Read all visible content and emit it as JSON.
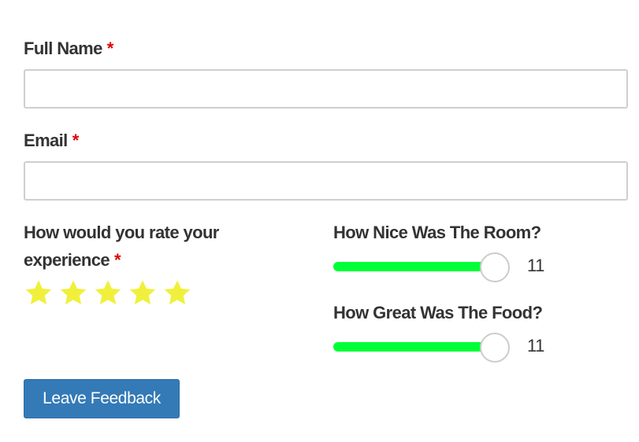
{
  "form": {
    "full_name": {
      "label": "Full Name",
      "required_mark": "*",
      "value": "",
      "placeholder": ""
    },
    "email": {
      "label": "Email",
      "required_mark": "*",
      "value": "",
      "placeholder": ""
    },
    "rating": {
      "label_line1": "How would you rate your",
      "label_line2": "experience",
      "required_mark": "*",
      "value": 5,
      "max": 5,
      "star_color": "#f0f03c"
    },
    "room_slider": {
      "label": "How Nice Was The Room?",
      "value": "11",
      "fraction": 1.0
    },
    "food_slider": {
      "label": "How Great Was The Food?",
      "value": "11",
      "fraction": 1.0
    },
    "submit_label": "Leave Feedback"
  },
  "colors": {
    "accent": "#337ab7",
    "slider_fill": "#00ff37",
    "required": "#e00000"
  }
}
